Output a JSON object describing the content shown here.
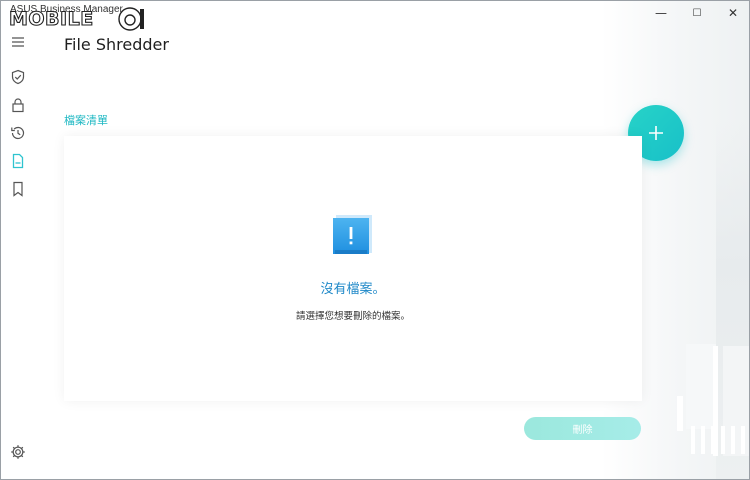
{
  "window": {
    "app_title": "ASUS Business Manager",
    "watermark_text": "MOBILE01",
    "controls": {
      "minimize": "—",
      "maximize": "☐",
      "close": "✕"
    }
  },
  "sidebar": {
    "items": [
      {
        "name": "menu-icon"
      },
      {
        "name": "shield-check-icon"
      },
      {
        "name": "lock-icon"
      },
      {
        "name": "history-icon"
      },
      {
        "name": "document-icon",
        "active": true
      },
      {
        "name": "bookmark-icon"
      },
      {
        "name": "settings-gear-icon"
      }
    ]
  },
  "main": {
    "page_title": "File Shredder",
    "section_label": "檔案清單",
    "add_button_label": "+",
    "empty_state": {
      "title": "沒有檔案。",
      "description": "請選擇您想要刪除的檔案。"
    },
    "delete_button_label": "刪除"
  },
  "colors": {
    "accent": "#1fb8c3",
    "add_button": "#22c9c8",
    "empty_title": "#1e88c8",
    "delete_button": "#9fe9e1",
    "active_sidebar_icon": "#2ec4cf"
  }
}
